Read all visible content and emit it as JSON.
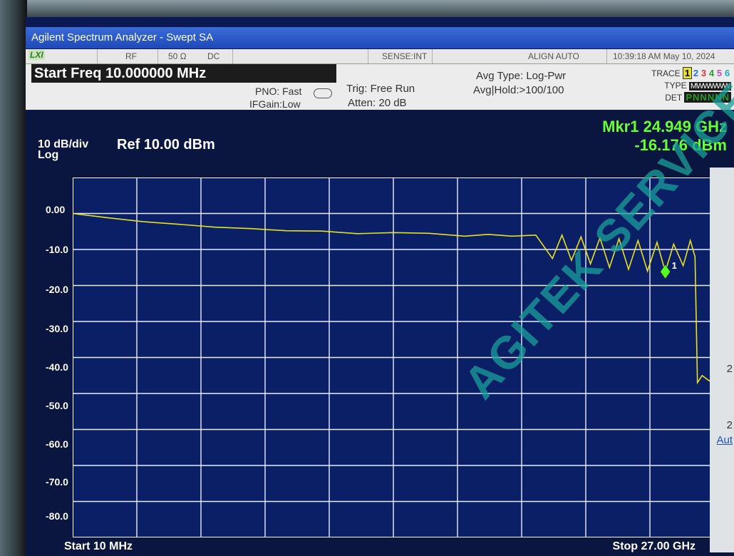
{
  "window": {
    "title": "Agilent Spectrum Analyzer - Swept SA"
  },
  "status_bar": {
    "lxi": "LXI",
    "rf": "RF",
    "impedance": "50 Ω",
    "coupling": "DC",
    "sense": "SENSE:INT",
    "align": "ALIGN AUTO",
    "datetime": "10:39:18 AM May 10, 2024"
  },
  "settings": {
    "start_freq": "Start Freq 10.000000 MHz",
    "pno": "PNO: Fast",
    "ifgain": "IFGain:Low",
    "trig": "Trig: Free Run",
    "atten": "Atten: 20 dB",
    "avg_type": "Avg Type: Log-Pwr",
    "avg_hold": "Avg|Hold:>100/100"
  },
  "trace_panel": {
    "trace_label": "TRACE",
    "trace_numbers": [
      "1",
      "2",
      "3",
      "4",
      "5",
      "6"
    ],
    "type_label": "TYPE",
    "type_value": "MWWWWW",
    "det_label": "DET",
    "det_value": "PNNNNN"
  },
  "display": {
    "scale": "10 dB/div",
    "scale_type": "Log",
    "ref_level": "Ref 10.00 dBm",
    "marker_freq": "Mkr1 24.949 GHz",
    "marker_amp": "-16.176 dBm",
    "marker_label": "1",
    "y_ticks": [
      "0.00",
      "-10.0",
      "-20.0",
      "-30.0",
      "-40.0",
      "-50.0",
      "-60.0",
      "-70.0",
      "-80.0"
    ],
    "start": "Start 10 MHz",
    "stop": "Stop 27.00 GHz"
  },
  "softkeys": [
    "2",
    "2",
    "Aut"
  ],
  "watermark": "AGITEK SERVICE",
  "chart_data": {
    "type": "line",
    "xlabel": "",
    "ylabel": "",
    "xlim": [
      0.01,
      27.0
    ],
    "ylim": [
      -90,
      10
    ],
    "series": [
      {
        "x": [
          0.01,
          1.5,
          3,
          4.5,
          6,
          7.5,
          9,
          10.5,
          12,
          13.5,
          15,
          16.5,
          17.5,
          18.5,
          19.5,
          20.2,
          20.6,
          21,
          21.4,
          21.8,
          22.2,
          22.6,
          23,
          23.4,
          23.8,
          24.2,
          24.6,
          24.949,
          25.3,
          25.7,
          26.0,
          26.2,
          26.3,
          26.5,
          26.8,
          27.0
        ],
        "y": [
          0.0,
          -1.2,
          -2.3,
          -3.0,
          -3.8,
          -4.2,
          -4.8,
          -4.9,
          -5.6,
          -5.3,
          -5.5,
          -6.3,
          -5.8,
          -6.3,
          -6.0,
          -12.5,
          -6.0,
          -13,
          -6.5,
          -14,
          -6.8,
          -15,
          -7.0,
          -15.5,
          -7.5,
          -16,
          -8.0,
          -16.176,
          -8.5,
          -14.5,
          -7.5,
          -12.0,
          -47.0,
          -45.0,
          -46.5,
          -46.0
        ],
        "color": "#e7e022"
      }
    ],
    "marker": {
      "x": 24.949,
      "y": -16.176
    },
    "grid": true
  }
}
